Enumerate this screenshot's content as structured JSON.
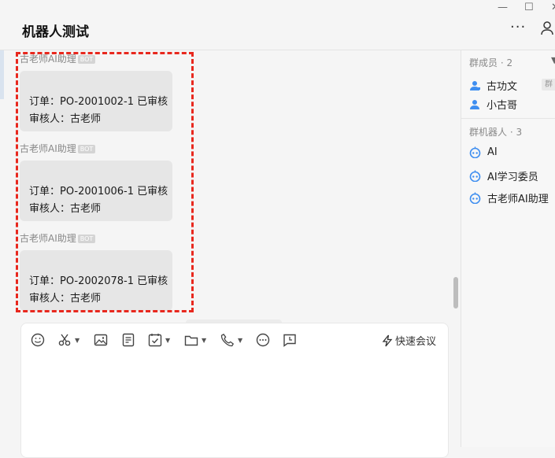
{
  "window": {
    "minimize": "—",
    "maximize": "☐",
    "close": "✕"
  },
  "header": {
    "title": "机器人测试",
    "more": "···"
  },
  "messages": [
    {
      "sender": "古老师AI助理",
      "badge": "BOT",
      "line1": "订单：PO-2001002-1 已审核",
      "line2": "审核人：古老师"
    },
    {
      "sender": "古老师AI助理",
      "badge": "BOT",
      "line1": "订单：PO-2001006-1 已审核",
      "line2": "审核人：古老师"
    },
    {
      "sender": "古老师AI助理",
      "badge": "BOT",
      "line1": "订单：PO-2002078-1 已审核",
      "line2": "审核人：古老师"
    }
  ],
  "members": {
    "label": "群成员 · 2",
    "caret": "▼",
    "items": [
      {
        "name": "古功文",
        "tag": "群主"
      },
      {
        "name": "小古哥"
      }
    ]
  },
  "robots": {
    "label": "群机器人 · 3",
    "items": [
      {
        "name": "AI"
      },
      {
        "name": "AI学习委员"
      },
      {
        "name": "古老师AI助理"
      }
    ]
  },
  "composer": {
    "quick_meeting": "快速会议"
  },
  "colors": {
    "accent": "#3e8ef0",
    "highlight_border": "#e8281e"
  }
}
